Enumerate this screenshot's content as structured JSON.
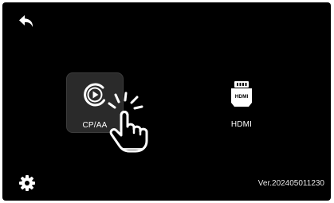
{
  "sources": [
    {
      "label": "CP/AA",
      "icon": "carplay-play-icon",
      "selected": true
    },
    {
      "label": "HDMI",
      "icon": "hdmi-connector-icon",
      "selected": false
    }
  ],
  "version_text": "Ver.202405011230",
  "icons": {
    "back": "back-arrow-icon",
    "settings": "gear-icon",
    "cursor": "tap-hand-icon"
  },
  "colors": {
    "background": "#000000",
    "selected_tile": "#2a2a2a",
    "text": "#ffffff"
  }
}
